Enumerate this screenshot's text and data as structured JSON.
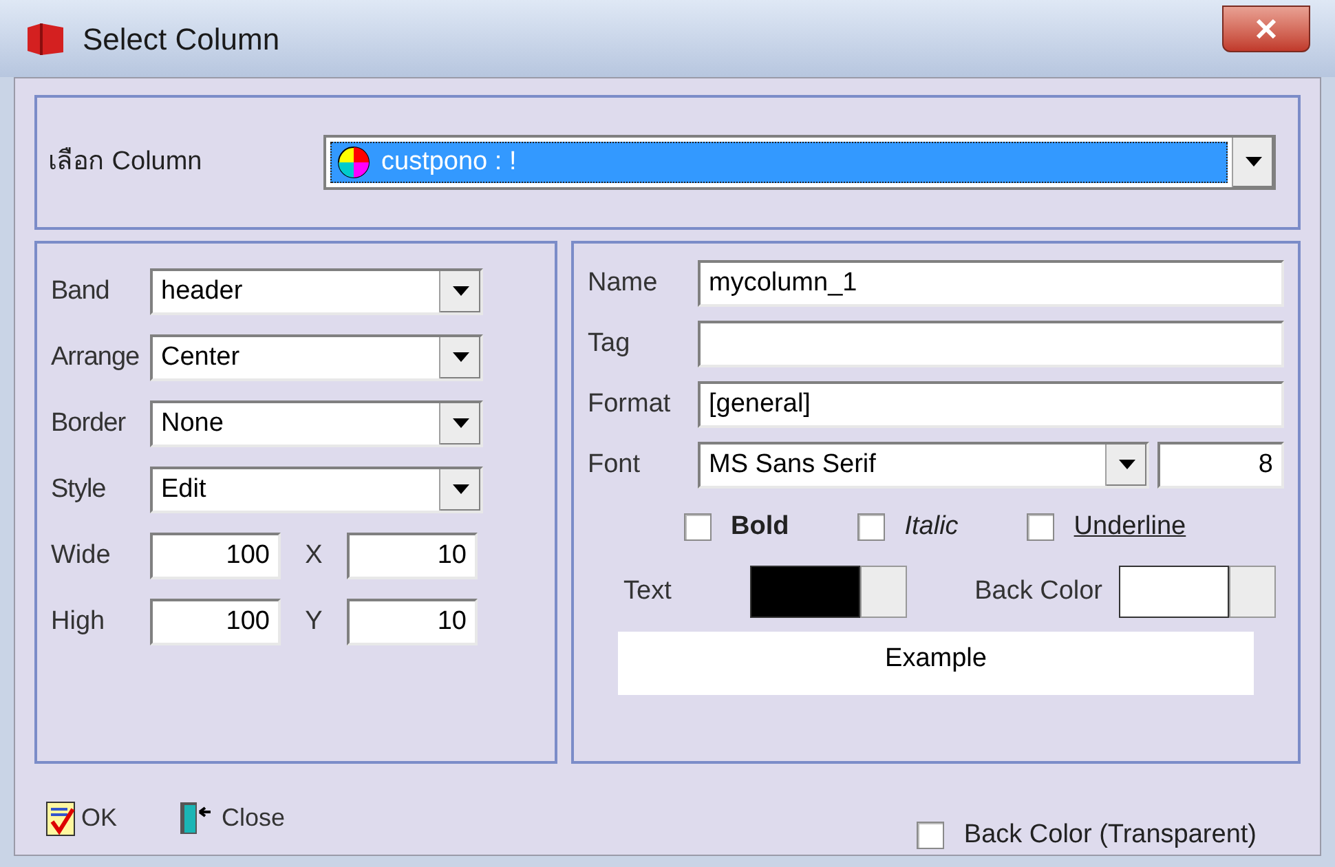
{
  "window": {
    "title": "Select Column"
  },
  "column_select": {
    "label": "เลือก Column",
    "value": "custpono : !"
  },
  "left_fields": [
    {
      "kind": "dropdown",
      "label": "Band",
      "value": "header"
    },
    {
      "kind": "dropdown",
      "label": "Arrange",
      "value": "Center"
    },
    {
      "kind": "dropdown",
      "label": "Border",
      "value": "None"
    },
    {
      "kind": "dropdown",
      "label": "Style",
      "value": "Edit"
    },
    {
      "kind": "pair",
      "label": "Wide",
      "value": "100",
      "label2": "X",
      "value2": "10"
    },
    {
      "kind": "pair",
      "label": "High",
      "value": "100",
      "label2": "Y",
      "value2": "10"
    }
  ],
  "right_fields": [
    {
      "kind": "text",
      "label": "Name",
      "value": "mycolumn_1"
    },
    {
      "kind": "text",
      "label": "Tag"
    },
    {
      "kind": "text",
      "label": "Format",
      "value": "[general]"
    },
    {
      "kind": "font",
      "label": "Font",
      "value": "MS Sans Serif",
      "size": "8"
    }
  ],
  "font_styles": [
    {
      "kind": "bold",
      "label": "Bold",
      "checked": false
    },
    {
      "kind": "italic",
      "label": "Italic",
      "checked": false
    },
    {
      "kind": "underline",
      "label": "Underline",
      "checked": false
    }
  ],
  "colors": [
    {
      "label": "Text",
      "color": "#000000"
    },
    {
      "label": "Back Color",
      "color": "#ffffff"
    }
  ],
  "example": "Example",
  "buttons": [
    {
      "kind": "ok",
      "label": "OK"
    },
    {
      "kind": "close",
      "label": "Close"
    }
  ],
  "transparent": {
    "label": "Back Color (Transparent)",
    "checked": false
  }
}
